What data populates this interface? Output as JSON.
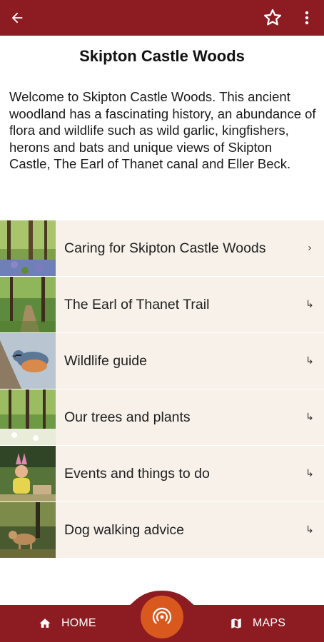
{
  "appbar": {
    "back_icon": "arrow-back-icon",
    "favorite_icon": "star-outline-icon",
    "more_icon": "more-vert-icon",
    "color": "#8d1b22"
  },
  "page": {
    "title": "Skipton Castle Woods",
    "intro": "Welcome to Skipton Castle Woods. This ancient woodland has a fascinating history, an abundance of flora and wildlife such as wild garlic, kingfishers, herons and bats and unique views of Skipton Castle, The Earl of Thanet canal and Eller Beck."
  },
  "menu": {
    "items": [
      {
        "label": "Caring for Skipton Castle Woods",
        "arrow": "›"
      },
      {
        "label": "The Earl of Thanet Trail",
        "arrow": "↳"
      },
      {
        "label": "Wildlife guide",
        "arrow": "↳"
      },
      {
        "label": "Our trees and plants",
        "arrow": "↳"
      },
      {
        "label": "Events and things to do",
        "arrow": "↳"
      },
      {
        "label": "Dog walking advice",
        "arrow": "↳"
      }
    ],
    "background": "#f7f1ea"
  },
  "bottom_nav": {
    "home_label": "HOME",
    "maps_label": "MAPS",
    "home_icon": "home-icon",
    "maps_icon": "map-icon",
    "center_icon": "nfc-signal-icon",
    "fab_color": "#d9581e"
  }
}
